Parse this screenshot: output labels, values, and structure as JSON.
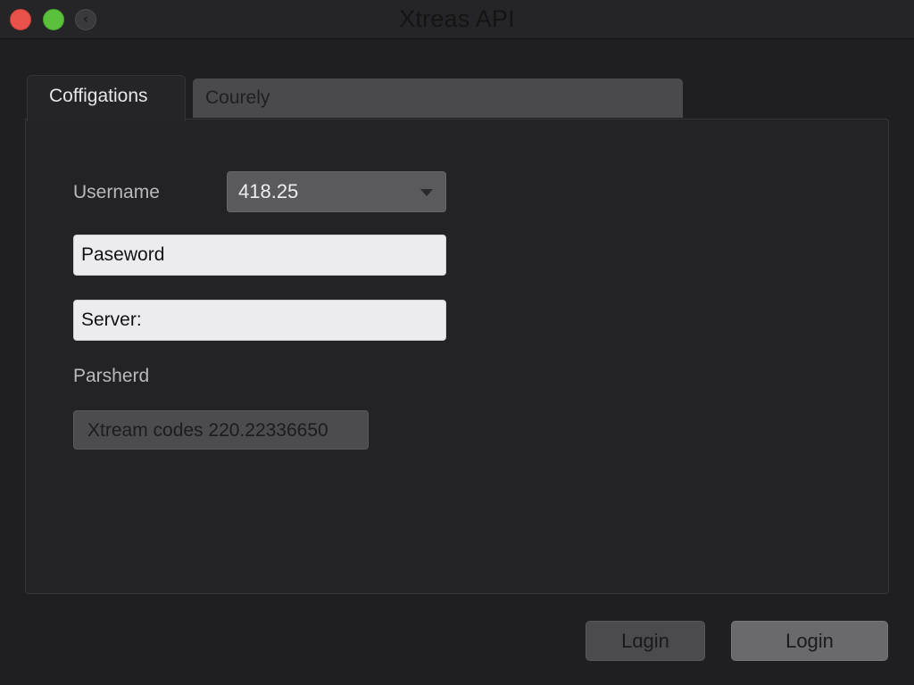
{
  "window": {
    "title": "Xtreas API",
    "back_glyph": "‹"
  },
  "tabs": [
    {
      "label": "Coffigations",
      "active": true
    },
    {
      "label": "Courely",
      "active": false
    }
  ],
  "form": {
    "username_label": "Username",
    "username_value": "418.25",
    "password_field": "Paseword",
    "server_field": "Server:",
    "parsherd_label": "Parsherd",
    "info_text": "Xtream codes 220.22336650"
  },
  "buttons": {
    "login_secondary": "Lɑgin",
    "login_primary": "Login"
  },
  "colors": {
    "background": "#1f1f21",
    "close": "#e8524b",
    "zoom": "#5bc13d"
  },
  "icons": [
    "close-icon",
    "zoom-icon",
    "back-icon",
    "chevron-down-icon"
  ]
}
